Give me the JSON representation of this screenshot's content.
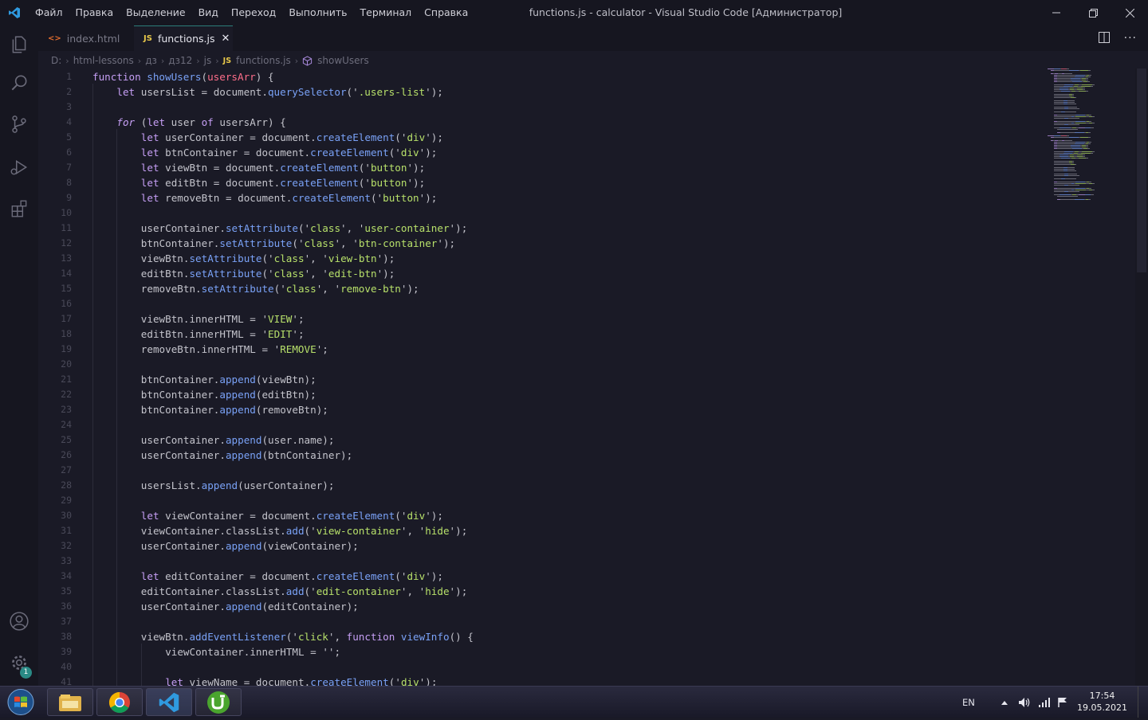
{
  "window": {
    "title": "functions.js - calculator - Visual Studio Code [Администратор]",
    "menu": [
      "Файл",
      "Правка",
      "Выделение",
      "Вид",
      "Переход",
      "Выполнить",
      "Терминал",
      "Справка"
    ]
  },
  "tabs": [
    {
      "label": "index.html",
      "icon": "html-icon",
      "active": false
    },
    {
      "label": "functions.js",
      "icon": "js-icon",
      "icon_text": "JS",
      "active": true
    }
  ],
  "breadcrumb": [
    "D:",
    "html-lessons",
    "дз",
    "дз12",
    "js",
    "functions.js",
    "showUsers"
  ],
  "breadcrumb_js_badge": "JS",
  "editor": {
    "lines": [
      {
        "n": "1",
        "indent": 0,
        "t": [
          [
            "kw",
            "function "
          ],
          [
            "fn",
            "showUsers"
          ],
          [
            "plain",
            "("
          ],
          [
            "param",
            "usersArr"
          ],
          [
            "plain",
            ") {"
          ]
        ]
      },
      {
        "n": "2",
        "indent": 1,
        "t": [
          [
            "kw",
            "let "
          ],
          [
            "plain",
            "usersList = document."
          ],
          [
            "fn",
            "querySelector"
          ],
          [
            "plain",
            "('"
          ],
          [
            "str",
            ".users-list"
          ],
          [
            "plain",
            "');"
          ]
        ]
      },
      {
        "n": "3",
        "indent": 0,
        "t": []
      },
      {
        "n": "4",
        "indent": 1,
        "t": [
          [
            "kwi",
            "for"
          ],
          [
            "plain",
            " ("
          ],
          [
            "kw",
            "let "
          ],
          [
            "plain",
            "user "
          ],
          [
            "kw",
            "of "
          ],
          [
            "plain",
            "usersArr) {"
          ]
        ]
      },
      {
        "n": "5",
        "indent": 2,
        "t": [
          [
            "kw",
            "let "
          ],
          [
            "plain",
            "userContainer = document."
          ],
          [
            "fn",
            "createElement"
          ],
          [
            "plain",
            "('"
          ],
          [
            "str",
            "div"
          ],
          [
            "plain",
            "');"
          ]
        ]
      },
      {
        "n": "6",
        "indent": 2,
        "t": [
          [
            "kw",
            "let "
          ],
          [
            "plain",
            "btnContainer = document."
          ],
          [
            "fn",
            "createElement"
          ],
          [
            "plain",
            "('"
          ],
          [
            "str",
            "div"
          ],
          [
            "plain",
            "');"
          ]
        ]
      },
      {
        "n": "7",
        "indent": 2,
        "t": [
          [
            "kw",
            "let "
          ],
          [
            "plain",
            "viewBtn = document."
          ],
          [
            "fn",
            "createElement"
          ],
          [
            "plain",
            "('"
          ],
          [
            "str",
            "button"
          ],
          [
            "plain",
            "');"
          ]
        ]
      },
      {
        "n": "8",
        "indent": 2,
        "t": [
          [
            "kw",
            "let "
          ],
          [
            "plain",
            "editBtn = document."
          ],
          [
            "fn",
            "createElement"
          ],
          [
            "plain",
            "('"
          ],
          [
            "str",
            "button"
          ],
          [
            "plain",
            "');"
          ]
        ]
      },
      {
        "n": "9",
        "indent": 2,
        "t": [
          [
            "kw",
            "let "
          ],
          [
            "plain",
            "removeBtn = document."
          ],
          [
            "fn",
            "createElement"
          ],
          [
            "plain",
            "('"
          ],
          [
            "str",
            "button"
          ],
          [
            "plain",
            "');"
          ]
        ]
      },
      {
        "n": "10",
        "indent": 0,
        "t": []
      },
      {
        "n": "11",
        "indent": 2,
        "t": [
          [
            "plain",
            "userContainer."
          ],
          [
            "fn",
            "setAttribute"
          ],
          [
            "plain",
            "('"
          ],
          [
            "str",
            "class"
          ],
          [
            "plain",
            "', '"
          ],
          [
            "str",
            "user-container"
          ],
          [
            "plain",
            "');"
          ]
        ]
      },
      {
        "n": "12",
        "indent": 2,
        "t": [
          [
            "plain",
            "btnContainer."
          ],
          [
            "fn",
            "setAttribute"
          ],
          [
            "plain",
            "('"
          ],
          [
            "str",
            "class"
          ],
          [
            "plain",
            "', '"
          ],
          [
            "str",
            "btn-container"
          ],
          [
            "plain",
            "');"
          ]
        ]
      },
      {
        "n": "13",
        "indent": 2,
        "t": [
          [
            "plain",
            "viewBtn."
          ],
          [
            "fn",
            "setAttribute"
          ],
          [
            "plain",
            "('"
          ],
          [
            "str",
            "class"
          ],
          [
            "plain",
            "', '"
          ],
          [
            "str",
            "view-btn"
          ],
          [
            "plain",
            "');"
          ]
        ]
      },
      {
        "n": "14",
        "indent": 2,
        "t": [
          [
            "plain",
            "editBtn."
          ],
          [
            "fn",
            "setAttribute"
          ],
          [
            "plain",
            "('"
          ],
          [
            "str",
            "class"
          ],
          [
            "plain",
            "', '"
          ],
          [
            "str",
            "edit-btn"
          ],
          [
            "plain",
            "');"
          ]
        ]
      },
      {
        "n": "15",
        "indent": 2,
        "t": [
          [
            "plain",
            "removeBtn."
          ],
          [
            "fn",
            "setAttribute"
          ],
          [
            "plain",
            "('"
          ],
          [
            "str",
            "class"
          ],
          [
            "plain",
            "', '"
          ],
          [
            "str",
            "remove-btn"
          ],
          [
            "plain",
            "');"
          ]
        ]
      },
      {
        "n": "16",
        "indent": 0,
        "t": []
      },
      {
        "n": "17",
        "indent": 2,
        "t": [
          [
            "plain",
            "viewBtn.innerHTML = '"
          ],
          [
            "str",
            "VIEW"
          ],
          [
            "plain",
            "';"
          ]
        ]
      },
      {
        "n": "18",
        "indent": 2,
        "t": [
          [
            "plain",
            "editBtn.innerHTML = '"
          ],
          [
            "str",
            "EDIT"
          ],
          [
            "plain",
            "';"
          ]
        ]
      },
      {
        "n": "19",
        "indent": 2,
        "t": [
          [
            "plain",
            "removeBtn.innerHTML = '"
          ],
          [
            "str",
            "REMOVE"
          ],
          [
            "plain",
            "';"
          ]
        ]
      },
      {
        "n": "20",
        "indent": 0,
        "t": []
      },
      {
        "n": "21",
        "indent": 2,
        "t": [
          [
            "plain",
            "btnContainer."
          ],
          [
            "fn",
            "append"
          ],
          [
            "plain",
            "(viewBtn);"
          ]
        ]
      },
      {
        "n": "22",
        "indent": 2,
        "t": [
          [
            "plain",
            "btnContainer."
          ],
          [
            "fn",
            "append"
          ],
          [
            "plain",
            "(editBtn);"
          ]
        ]
      },
      {
        "n": "23",
        "indent": 2,
        "t": [
          [
            "plain",
            "btnContainer."
          ],
          [
            "fn",
            "append"
          ],
          [
            "plain",
            "(removeBtn);"
          ]
        ]
      },
      {
        "n": "24",
        "indent": 0,
        "t": []
      },
      {
        "n": "25",
        "indent": 2,
        "t": [
          [
            "plain",
            "userContainer."
          ],
          [
            "fn",
            "append"
          ],
          [
            "plain",
            "(user.name);"
          ]
        ]
      },
      {
        "n": "26",
        "indent": 2,
        "t": [
          [
            "plain",
            "userContainer."
          ],
          [
            "fn",
            "append"
          ],
          [
            "plain",
            "(btnContainer);"
          ]
        ]
      },
      {
        "n": "27",
        "indent": 0,
        "t": []
      },
      {
        "n": "28",
        "indent": 2,
        "t": [
          [
            "plain",
            "usersList."
          ],
          [
            "fn",
            "append"
          ],
          [
            "plain",
            "(userContainer);"
          ]
        ]
      },
      {
        "n": "29",
        "indent": 0,
        "t": []
      },
      {
        "n": "30",
        "indent": 2,
        "t": [
          [
            "kw",
            "let "
          ],
          [
            "plain",
            "viewContainer = document."
          ],
          [
            "fn",
            "createElement"
          ],
          [
            "plain",
            "('"
          ],
          [
            "str",
            "div"
          ],
          [
            "plain",
            "');"
          ]
        ]
      },
      {
        "n": "31",
        "indent": 2,
        "t": [
          [
            "plain",
            "viewContainer.classList."
          ],
          [
            "fn",
            "add"
          ],
          [
            "plain",
            "('"
          ],
          [
            "str",
            "view-container"
          ],
          [
            "plain",
            "', '"
          ],
          [
            "str",
            "hide"
          ],
          [
            "plain",
            "');"
          ]
        ]
      },
      {
        "n": "32",
        "indent": 2,
        "t": [
          [
            "plain",
            "userContainer."
          ],
          [
            "fn",
            "append"
          ],
          [
            "plain",
            "(viewContainer);"
          ]
        ]
      },
      {
        "n": "33",
        "indent": 0,
        "t": []
      },
      {
        "n": "34",
        "indent": 2,
        "t": [
          [
            "kw",
            "let "
          ],
          [
            "plain",
            "editContainer = document."
          ],
          [
            "fn",
            "createElement"
          ],
          [
            "plain",
            "('"
          ],
          [
            "str",
            "div"
          ],
          [
            "plain",
            "');"
          ]
        ]
      },
      {
        "n": "35",
        "indent": 2,
        "t": [
          [
            "plain",
            "editContainer.classList."
          ],
          [
            "fn",
            "add"
          ],
          [
            "plain",
            "('"
          ],
          [
            "str",
            "edit-container"
          ],
          [
            "plain",
            "', '"
          ],
          [
            "str",
            "hide"
          ],
          [
            "plain",
            "');"
          ]
        ]
      },
      {
        "n": "36",
        "indent": 2,
        "t": [
          [
            "plain",
            "userContainer."
          ],
          [
            "fn",
            "append"
          ],
          [
            "plain",
            "(editContainer);"
          ]
        ]
      },
      {
        "n": "37",
        "indent": 0,
        "t": []
      },
      {
        "n": "38",
        "indent": 2,
        "t": [
          [
            "plain",
            "viewBtn."
          ],
          [
            "fn",
            "addEventListener"
          ],
          [
            "plain",
            "('"
          ],
          [
            "str",
            "click"
          ],
          [
            "plain",
            "', "
          ],
          [
            "kw",
            "function "
          ],
          [
            "fn",
            "viewInfo"
          ],
          [
            "plain",
            "() {"
          ]
        ]
      },
      {
        "n": "39",
        "indent": 3,
        "t": [
          [
            "plain",
            "viewContainer.innerHTML = '';"
          ]
        ]
      },
      {
        "n": "40",
        "indent": 0,
        "t": []
      },
      {
        "n": "41",
        "indent": 3,
        "t": [
          [
            "kw",
            "let "
          ],
          [
            "plain",
            "viewName = document."
          ],
          [
            "fn",
            "createElement"
          ],
          [
            "plain",
            "('"
          ],
          [
            "str",
            "div"
          ],
          [
            "plain",
            "');"
          ]
        ]
      }
    ]
  },
  "colors": {
    "keyword": "#c69ff5",
    "function": "#7aa2f7",
    "string": "#b7e06a",
    "parameter": "#ff6e8a",
    "accent": "#2c7d7a"
  },
  "activity": {
    "settings_badge": "1"
  },
  "taskbar": {
    "apps": [
      "explorer-icon",
      "chrome-icon",
      "vscode-icon",
      "utorrent-icon"
    ],
    "language": "EN",
    "time": "17:54",
    "date": "19.05.2021"
  }
}
